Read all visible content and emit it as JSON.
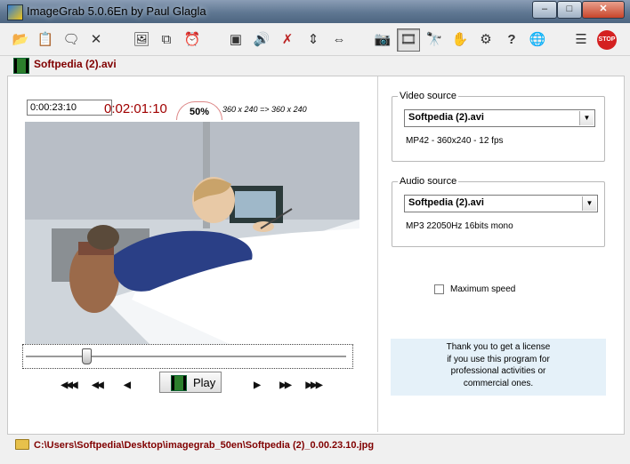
{
  "window": {
    "title": "ImageGrab 5.0.6En by Paul Glagla"
  },
  "titlebar_controls": {
    "minimize": "–",
    "maximize": "□",
    "close": "✕"
  },
  "toolbar": {
    "buttons": [
      {
        "id": "open",
        "icon": "open-folder-icon",
        "glyph": "📂"
      },
      {
        "id": "paste",
        "icon": "paste-icon",
        "glyph": "📋"
      },
      {
        "id": "comment",
        "icon": "comment-icon",
        "glyph": "🗨"
      },
      {
        "id": "close",
        "icon": "close-icon",
        "glyph": "✕"
      },
      {
        "id": "image-save",
        "icon": "image-save-icon",
        "glyph": "🖼"
      },
      {
        "id": "copy",
        "icon": "copy-icon",
        "glyph": "⧉"
      },
      {
        "id": "timer",
        "icon": "alarm-clock-icon",
        "glyph": "⏰"
      },
      {
        "id": "screen",
        "icon": "screen-icon",
        "glyph": "▣"
      },
      {
        "id": "volume",
        "icon": "speaker-icon",
        "glyph": "🔊"
      },
      {
        "id": "no-video",
        "icon": "no-video-icon",
        "glyph": "✗"
      },
      {
        "id": "flip-vertical",
        "icon": "flip-vertical-icon",
        "glyph": "⇕"
      },
      {
        "id": "flip-horizontal",
        "icon": "flip-horizontal-icon",
        "glyph": "⇔"
      },
      {
        "id": "camera",
        "icon": "camera-icon",
        "glyph": "📷"
      },
      {
        "id": "film",
        "icon": "film-icon",
        "glyph": "🎞"
      },
      {
        "id": "binoculars",
        "icon": "binoculars-icon",
        "glyph": "🔭"
      },
      {
        "id": "hand-image",
        "icon": "hand-image-icon",
        "glyph": "✋"
      },
      {
        "id": "settings",
        "icon": "settings-icon",
        "glyph": "⚙"
      },
      {
        "id": "help",
        "icon": "help-icon",
        "glyph": "?"
      },
      {
        "id": "globe",
        "icon": "globe-icon",
        "glyph": "🌐"
      },
      {
        "id": "list",
        "icon": "list-icon",
        "glyph": "☰"
      },
      {
        "id": "stop",
        "icon": "stop-icon",
        "glyph": "STOP"
      }
    ]
  },
  "file": {
    "name": "Softpedia (2).avi"
  },
  "player": {
    "position": "0:00:23:10",
    "duration": "0:02:01:10",
    "zoom": "50%",
    "resolution_info": "360 x 240  =>  360 x 240",
    "seek_fraction": 0.19,
    "play_label": "Play",
    "nav": {
      "fast_back": "◀◀◀",
      "step_back": "◀◀",
      "frame_back": "◀",
      "frame_forward": "▶",
      "step_forward": "▶▶",
      "fast_forward": "▶▶▶"
    }
  },
  "video_source": {
    "legend": "Video source",
    "selected": "Softpedia (2).avi",
    "info": "MP42 - 360x240 - 12 fps"
  },
  "audio_source": {
    "legend": "Audio source",
    "selected": "Softpedia (2).avi",
    "info": "MP3 22050Hz 16bits  mono"
  },
  "options": {
    "max_speed_label": "Maximum speed",
    "max_speed_checked": false
  },
  "license": {
    "line1": "Thank you to get a license",
    "line2": "if you use this program for",
    "line3": "professional activities or",
    "line4": "commercial ones."
  },
  "status": {
    "path": "C:\\Users\\Softpedia\\Desktop\\imagegrab_50en\\Softpedia (2)_0.00.23.10.jpg"
  },
  "colors": {
    "accent_red": "#800000",
    "duration_red": "#a00000",
    "license_bg": "#e5f1f9"
  }
}
